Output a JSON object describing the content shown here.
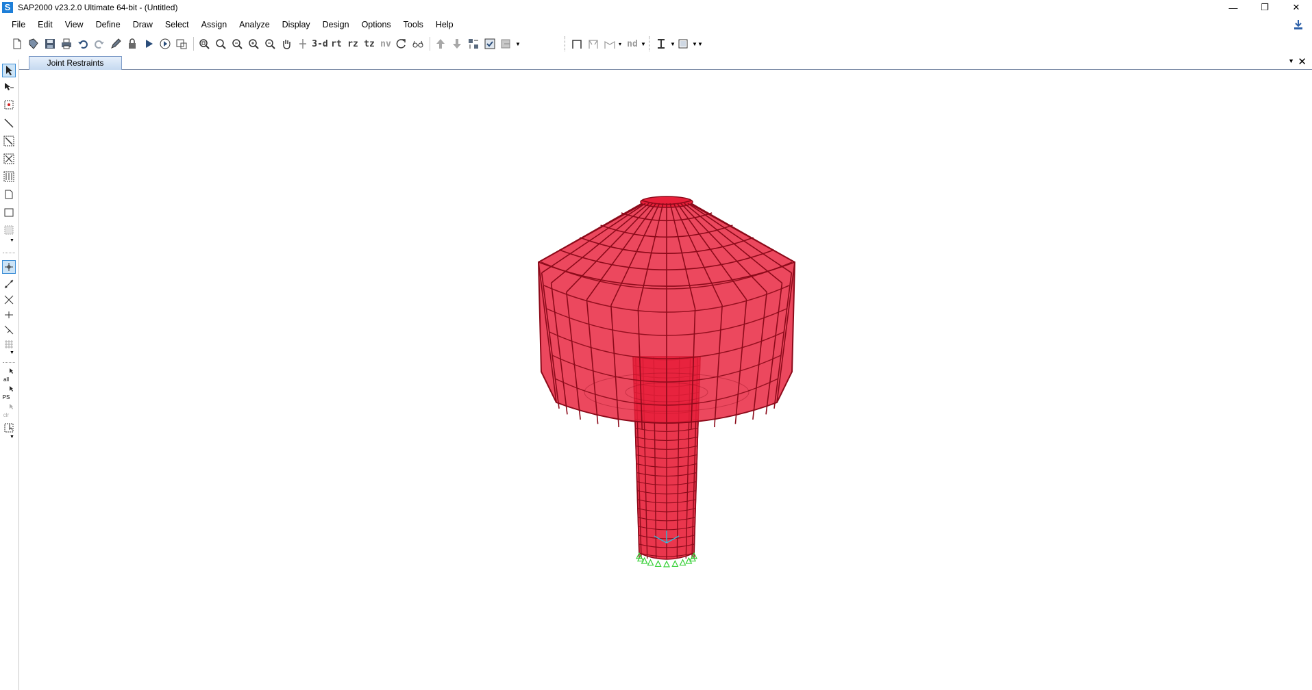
{
  "window": {
    "title": "SAP2000 v23.2.0 Ultimate 64-bit - (Untitled)",
    "logo_letter": "S",
    "minimize": "—",
    "restore": "❐",
    "close": "✕"
  },
  "menu": [
    "File",
    "Edit",
    "View",
    "Define",
    "Draw",
    "Select",
    "Assign",
    "Analyze",
    "Display",
    "Design",
    "Options",
    "Tools",
    "Help"
  ],
  "toolbar": {
    "view_3d": "3-d",
    "view_rt": "rt",
    "view_rz": "rz",
    "view_tz": "tz",
    "view_nv": "nv",
    "nd": "nd"
  },
  "tab": {
    "label": "Joint Restraints",
    "pin": "▼",
    "close": "✕"
  },
  "left_toolbar_labels": {
    "all": "all",
    "ps": "PS",
    "clr": "clr"
  },
  "colors": {
    "model_fill": "#e8203a",
    "model_stroke": "#8c0a1a",
    "restraint": "#35d035",
    "joint_axis": "#3cb7d4",
    "accent": "#3c8ed6"
  }
}
